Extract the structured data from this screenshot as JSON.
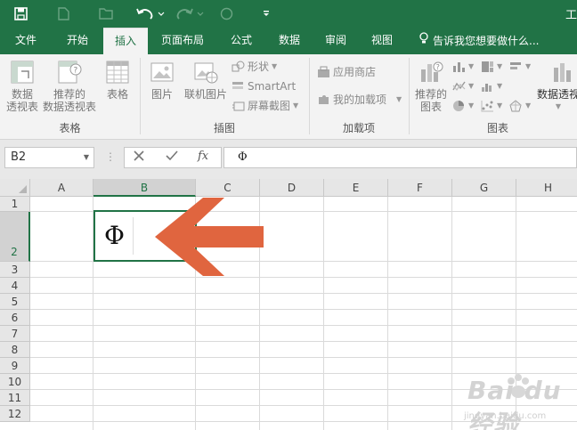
{
  "qat": {
    "icons": [
      "save-icon",
      "new-icon",
      "open-icon",
      "undo-icon",
      "redo-icon",
      "touch-icon",
      "customize-icon"
    ],
    "title_fragment": "工"
  },
  "tabs": [
    {
      "label": "文件"
    },
    {
      "label": "开始"
    },
    {
      "label": "插入"
    },
    {
      "label": "页面布局"
    },
    {
      "label": "公式"
    },
    {
      "label": "数据"
    },
    {
      "label": "审阅"
    },
    {
      "label": "视图"
    }
  ],
  "active_tab": "插入",
  "tellme": {
    "text": "告诉我您想要做什么..."
  },
  "ribbon": {
    "tables": {
      "label": "表格",
      "pivot": "数据\n透视表",
      "recommended_pivot": "推荐的\n数据透视表",
      "table": "表格"
    },
    "illustrations": {
      "label": "插图",
      "pictures": "图片",
      "online_pictures": "联机图片",
      "shapes": "形状",
      "smartart": "SmartArt",
      "screenshot": "屏幕截图"
    },
    "addins": {
      "label": "加载项",
      "store": "应用商店",
      "my_addins": "我的加载项"
    },
    "charts": {
      "label": "图表",
      "recommended": "推荐的\n图表",
      "pivotchart": "数据透视"
    }
  },
  "formula_bar": {
    "name_box": "B2",
    "content": "Φ"
  },
  "grid": {
    "columns": [
      "A",
      "B",
      "C",
      "D",
      "E",
      "F",
      "G",
      "H"
    ],
    "rows": [
      "1",
      "2",
      "3",
      "4",
      "5",
      "6",
      "7",
      "8",
      "9",
      "10",
      "11",
      "12"
    ],
    "selected_column": "B",
    "selected_row": "2",
    "cell_b2": "Φ"
  },
  "watermark": {
    "text": "Bai du 经验",
    "url": "jingyan.baidu.com"
  },
  "colors": {
    "accent": "#217346",
    "arrow": "#e0653f"
  }
}
